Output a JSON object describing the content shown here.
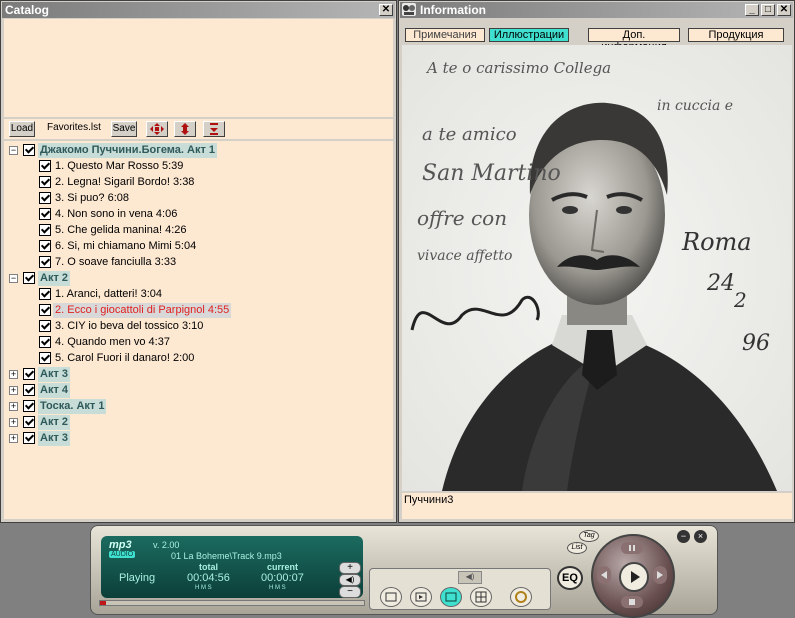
{
  "catalog": {
    "title": "Catalog",
    "close": "✕",
    "toolbar": {
      "load": "Load",
      "file": "Favorites.lst",
      "save": "Save"
    },
    "tree": [
      {
        "type": "group",
        "pm": "−",
        "label": "Джакомо Пуччини.Богема. Акт 1"
      },
      {
        "type": "item",
        "label": "1. Questo Mar Rosso 5:39"
      },
      {
        "type": "item",
        "label": "2. Legna! Sigaril Bordo! 3:38"
      },
      {
        "type": "item",
        "label": "3. Si puo? 6:08"
      },
      {
        "type": "item",
        "label": "4. Non sono in vena 4:06"
      },
      {
        "type": "item",
        "label": "5. Che gelida manina! 4:26"
      },
      {
        "type": "item",
        "label": "6. Si, mi chiamano Mimi 5:04"
      },
      {
        "type": "item",
        "label": "7. O soave fanciulla 3:33"
      },
      {
        "type": "group",
        "pm": "−",
        "label": "Акт 2"
      },
      {
        "type": "item",
        "label": "1. Aranci, datteri! 3:04"
      },
      {
        "type": "item",
        "label": "2. Ecco i giocattoli di Parpignol 4:55",
        "selected": true
      },
      {
        "type": "item",
        "label": "3. CIY io beva del tossico 3:10"
      },
      {
        "type": "item",
        "label": "4. Quando men vo 4:37"
      },
      {
        "type": "item",
        "label": "5. Carol Fuori il danaro! 2:00"
      },
      {
        "type": "group",
        "pm": "+",
        "label": "Акт 3"
      },
      {
        "type": "group",
        "pm": "+",
        "label": "Акт 4"
      },
      {
        "type": "group",
        "pm": "+",
        "label": "Тоска. Акт 1"
      },
      {
        "type": "group",
        "pm": "+",
        "label": "Акт 2"
      },
      {
        "type": "group",
        "pm": "+",
        "label": "Акт 3"
      }
    ]
  },
  "info": {
    "title": "Information",
    "min": "_",
    "max": "□",
    "close": "✕",
    "tabs": [
      "Примечания",
      "Иллюстрации",
      "Доп. информация",
      "Продукция"
    ],
    "active_tab": 1,
    "caption": "Пуччини3",
    "handwriting": [
      "A te o carissimo Collega",
      "in cuccia e",
      "a te amico",
      "San Martino",
      "offre con",
      "vivace affetto",
      "Roma",
      "24",
      "2",
      "96"
    ]
  },
  "player": {
    "logo": "mp3",
    "version": "v. 2.00",
    "audio_badge": "AUDIO",
    "track": "01 La Boheme\\Track 9.mp3",
    "status": "Playing",
    "total_label": "total",
    "total_time": "00:04:56",
    "current_label": "current",
    "current_time": "00:00:07",
    "hms": "H  M  S",
    "eq": "EQ",
    "tag_btn": "Tag",
    "list_btn": "List",
    "progress": 0.024
  },
  "colors": {
    "panel": "#fde8d2",
    "active_tab": "#40e0d0",
    "group_text": "#2f5a5a",
    "selected_text": "#e02020"
  }
}
